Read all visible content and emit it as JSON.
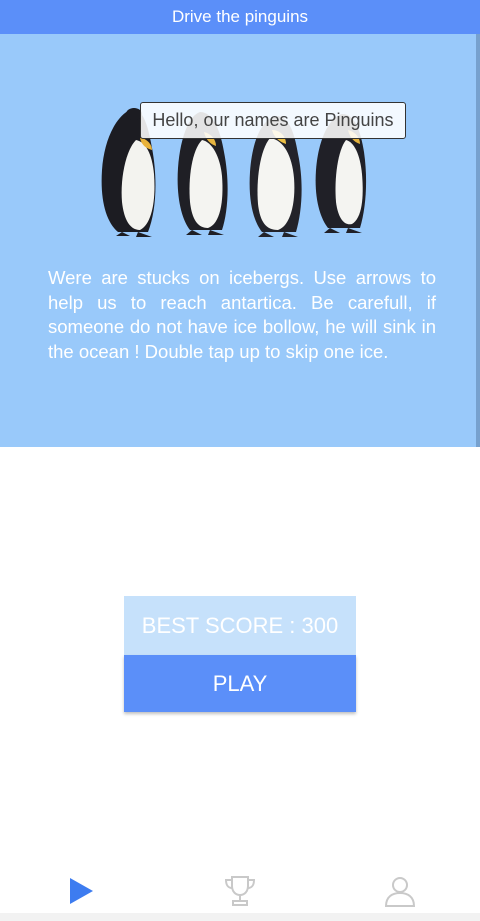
{
  "app": {
    "title": "Drive the pinguins"
  },
  "intro": {
    "speech_bubble": "Hello, our names are Pinguins",
    "instructions": "Were are stucks on icebergs. Use arrows to help us to reach antartica. Be carefull, if someone do not have ice bollow, he will sink in the ocean ! Double tap up to skip one ice."
  },
  "score": {
    "best_score_text": "BEST SCORE : 300"
  },
  "actions": {
    "play_label": "PLAY"
  },
  "bottom_nav": {
    "tabs": [
      {
        "icon": "play-icon",
        "active": true
      },
      {
        "icon": "trophy-icon",
        "active": false
      },
      {
        "icon": "person-icon",
        "active": false
      }
    ]
  },
  "colors": {
    "header": "#5b8ff9",
    "intro_background": "#99c9fa",
    "best_score_background": "#c6e1fb",
    "play_button": "#5b8ff9",
    "active_tab": "#3d7cf0",
    "inactive_tab": "#c9c9c9"
  }
}
